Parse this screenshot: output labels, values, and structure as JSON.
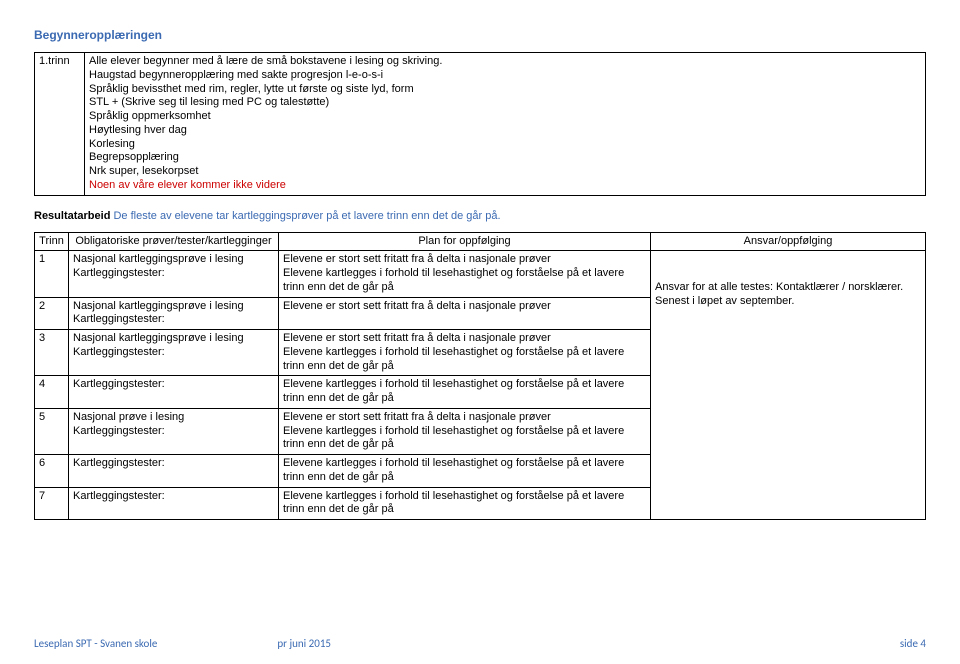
{
  "heading": "Begynneropplæringen",
  "intro": {
    "rowLabel": "1.trinn",
    "lines": [
      "Alle elever begynner med å lære de små bokstavene i lesing og skriving.",
      "Haugstad begynneropplæring med sakte progresjon l-e-o-s-i",
      "Språklig bevissthet med rim, regler, lytte ut første og siste lyd, form",
      "STL + (Skrive seg til lesing med PC og talestøtte)",
      "Språklig oppmerksomhet",
      "Høytlesing hver dag",
      "Korlesing",
      "Begrepsopplæring",
      "Nrk super, lesekorpset"
    ],
    "redLine": "Noen av våre elever kommer ikke videre"
  },
  "resultHeading": {
    "bold": "Resultatarbeid",
    "rest": "De fleste av elevene tar kartleggingsprøver på et lavere trinn enn det de går på."
  },
  "columns": {
    "c1": "Trinn",
    "c2": "Obligatoriske prøver/tester/kartlegginger",
    "c3": "Plan for oppfølging",
    "c4": "Ansvar/oppfølging"
  },
  "rows": [
    {
      "trinn": "1",
      "tests": "Nasjonal kartleggingsprøve i lesing\nKartleggingstester:",
      "plan": "Elevene er stort sett fritatt fra å delta i nasjonale prøver\nElevene kartlegges i forhold til lesehastighet og forståelse på et lavere trinn enn det de går på"
    },
    {
      "trinn": "2",
      "tests": "Nasjonal kartleggingsprøve i lesing\nKartleggingstester:",
      "plan": "Elevene er stort sett fritatt fra å delta i nasjonale prøver"
    },
    {
      "trinn": "3",
      "tests": "Nasjonal kartleggingsprøve i lesing\nKartleggingstester:",
      "plan": "Elevene er stort sett fritatt fra å delta i nasjonale prøver\nElevene kartlegges i forhold til lesehastighet og forståelse på et lavere trinn enn det de går på"
    },
    {
      "trinn": "4",
      "tests": "Kartleggingstester:",
      "plan": "Elevene kartlegges i forhold til lesehastighet og forståelse på et lavere trinn enn det de går på"
    },
    {
      "trinn": "5",
      "tests": "Nasjonal prøve i lesing\nKartleggingstester:",
      "plan": "Elevene er stort sett fritatt fra å delta i nasjonale prøver\nElevene kartlegges i forhold til lesehastighet og forståelse på et lavere trinn enn det de går på"
    },
    {
      "trinn": "6",
      "tests": "Kartleggingstester:",
      "plan": "Elevene kartlegges i forhold til lesehastighet og forståelse på et lavere trinn enn det de går på"
    },
    {
      "trinn": "7",
      "tests": "Kartleggingstester:",
      "plan": "Elevene kartlegges i forhold til lesehastighet og forståelse på et lavere trinn enn det de går på"
    }
  ],
  "ansvar": "Ansvar for at alle testes: Kontaktlærer / norsklærer.\nSenest i løpet av september.",
  "footer": {
    "left": "Leseplan SPT - Svanen skole",
    "mid": "pr juni 2015",
    "right": "side 4"
  }
}
